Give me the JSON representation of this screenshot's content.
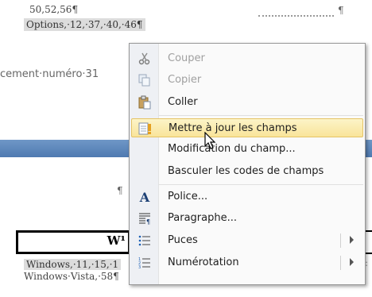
{
  "document": {
    "line_top": "50,52,56¶",
    "line_options": "Options,·12,·37,·40,·46¶",
    "line_placement": "cement·numéro·31",
    "pilcrow_right": "¶",
    "pilcrow_middle": "¶",
    "heading_partial": "W¹",
    "line_windows": "Windows,·11,·15,·1",
    "line_vista": "Windows·Vista,·58¶",
    "dots": "::::"
  },
  "menu": {
    "items": [
      {
        "label": "Couper",
        "icon": "scissors-icon",
        "glyph": "✂",
        "enabled": false
      },
      {
        "label": "Copier",
        "icon": "copy-icon",
        "glyph": "⎘",
        "enabled": false
      },
      {
        "label": "Coller",
        "icon": "paste-icon",
        "glyph": "📋",
        "enabled": true
      },
      {
        "label": "Mettre à jour les champs",
        "icon": "update-fields-icon",
        "glyph": "!",
        "enabled": true,
        "highlighted": true
      },
      {
        "label": "Modification du champ...",
        "icon": "",
        "enabled": true
      },
      {
        "label": "Basculer les codes de champs",
        "icon": "",
        "enabled": true
      },
      {
        "label": "Police...",
        "icon": "font-icon",
        "glyph": "A",
        "enabled": true
      },
      {
        "label": "Paragraphe...",
        "icon": "paragraph-icon",
        "glyph": "≣",
        "enabled": true
      },
      {
        "label": "Puces",
        "icon": "bullets-icon",
        "glyph": "☰",
        "enabled": true,
        "submenu": true
      },
      {
        "label": "Numérotation",
        "icon": "numbering-icon",
        "glyph": "☰",
        "enabled": true,
        "submenu": true
      }
    ]
  },
  "colors": {
    "highlight": "#f9e49a",
    "blue_band": "#5a84ba"
  }
}
